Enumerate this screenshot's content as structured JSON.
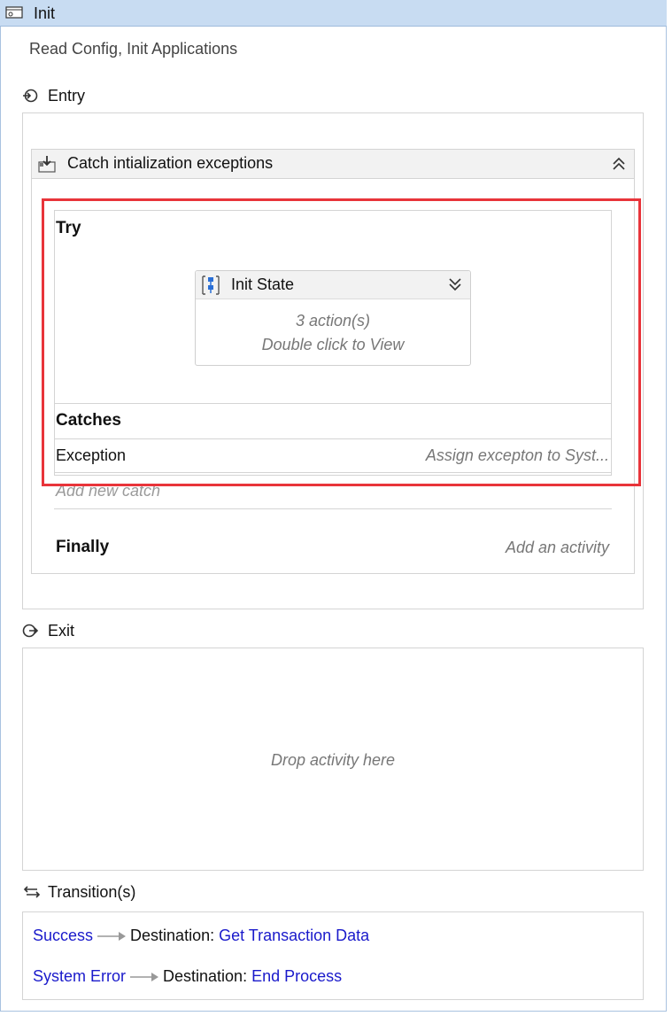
{
  "state": {
    "title": "Init",
    "description": "Read Config, Init Applications",
    "entry_label": "Entry",
    "exit_label": "Exit",
    "transitions_label": "Transition(s)"
  },
  "try_catch": {
    "title": "Catch intialization exceptions",
    "try_label": "Try",
    "sequence": {
      "title": "Init State",
      "actions": "3 action(s)",
      "hint": "Double click to View"
    },
    "catches_label": "Catches",
    "catch_rows": [
      {
        "exception": "Exception",
        "handler": "Assign excepton to Syst..."
      }
    ],
    "add_catch": "Add new catch",
    "finally_label": "Finally",
    "finally_placeholder": "Add an activity"
  },
  "exit_drop": "Drop activity here",
  "transitions": [
    {
      "trigger": "Success",
      "dest_label": "Destination:",
      "destination": "Get Transaction Data"
    },
    {
      "trigger": "System Error",
      "dest_label": "Destination:",
      "destination": "End Process"
    }
  ],
  "colors": {
    "titlebar": "#c8dcf2",
    "highlight": "#e8343a",
    "link": "#1a1acb"
  }
}
